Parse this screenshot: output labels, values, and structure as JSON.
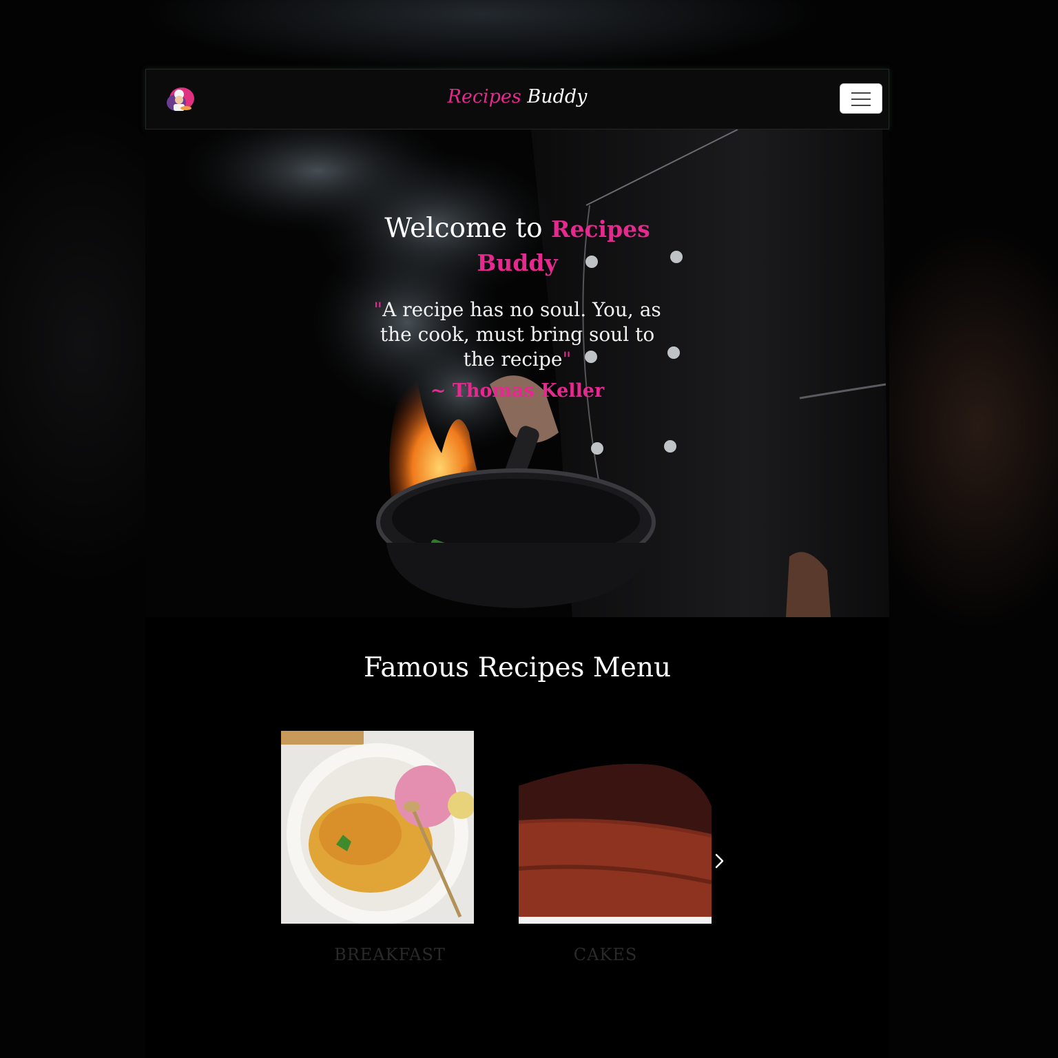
{
  "app": {
    "brand_part1": "Recipes",
    "brand_part2": "Buddy",
    "logo_icon": "chef-logo-icon",
    "menu_icon": "hamburger-menu-icon"
  },
  "hero": {
    "title_prefix": "Welcome to",
    "title_highlight": "Recipes Buddy",
    "quote_open": "\"",
    "quote_text": "A recipe has no soul. You, as the cook, must bring soul to the recipe",
    "quote_close": "\"",
    "author": "~ Thomas Keller"
  },
  "menu": {
    "heading": "Famous Recipes Menu",
    "cards": [
      {
        "label": "BREAKFAST"
      },
      {
        "label": "CAKES"
      }
    ],
    "next_icon": "chevron-right-icon"
  },
  "colors": {
    "accent": "#e6298f",
    "background": "#000000",
    "text": "#ffffff"
  }
}
